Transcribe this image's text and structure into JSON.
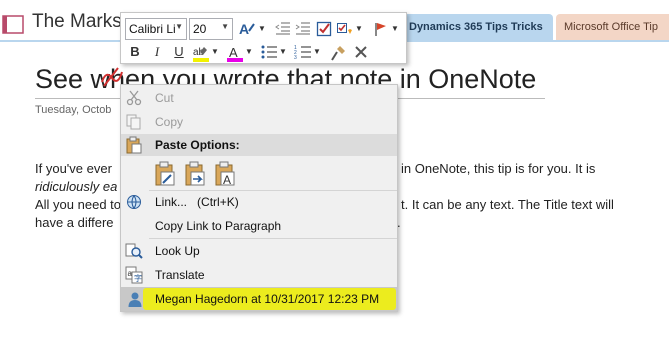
{
  "header": {
    "notebook_title": "The Marks",
    "tabs": [
      {
        "label": "Dynamics 365 Tips Tricks"
      },
      {
        "label": "Microsoft Office Tip"
      }
    ]
  },
  "page": {
    "title": "See when you wrote that note in OneNote",
    "date": "Tuesday, Octob",
    "lines": [
      {
        "left": "If you've ever",
        "right": "in OneNote, this tip is for you. It is"
      },
      {
        "left": "ridiculously ea",
        "right": ""
      },
      {
        "left": "All you need to",
        "right": "t. It can be any text. The Title text will"
      },
      {
        "left": "have a differe",
        "right": "."
      }
    ]
  },
  "mini_toolbar": {
    "font_name": "Calibri Li",
    "font_size": "20",
    "bold": "B",
    "italic": "I",
    "underline": "U"
  },
  "context_menu": {
    "cut": "Cut",
    "copy": "Copy",
    "paste_options": "Paste Options:",
    "link": "Link...",
    "link_shortcut": "(Ctrl+K)",
    "copy_link": "Copy Link to Paragraph",
    "look_up": "Look Up",
    "translate": "Translate",
    "author": "Megan Hagedorn at 10/31/2017 12:23 PM"
  },
  "colors": {
    "highlight_yellow": "#f2f200",
    "font_color_magenta": "#e800e8",
    "tab_blue": "#b9d6ee",
    "tab_peach": "#f3d6c6"
  }
}
